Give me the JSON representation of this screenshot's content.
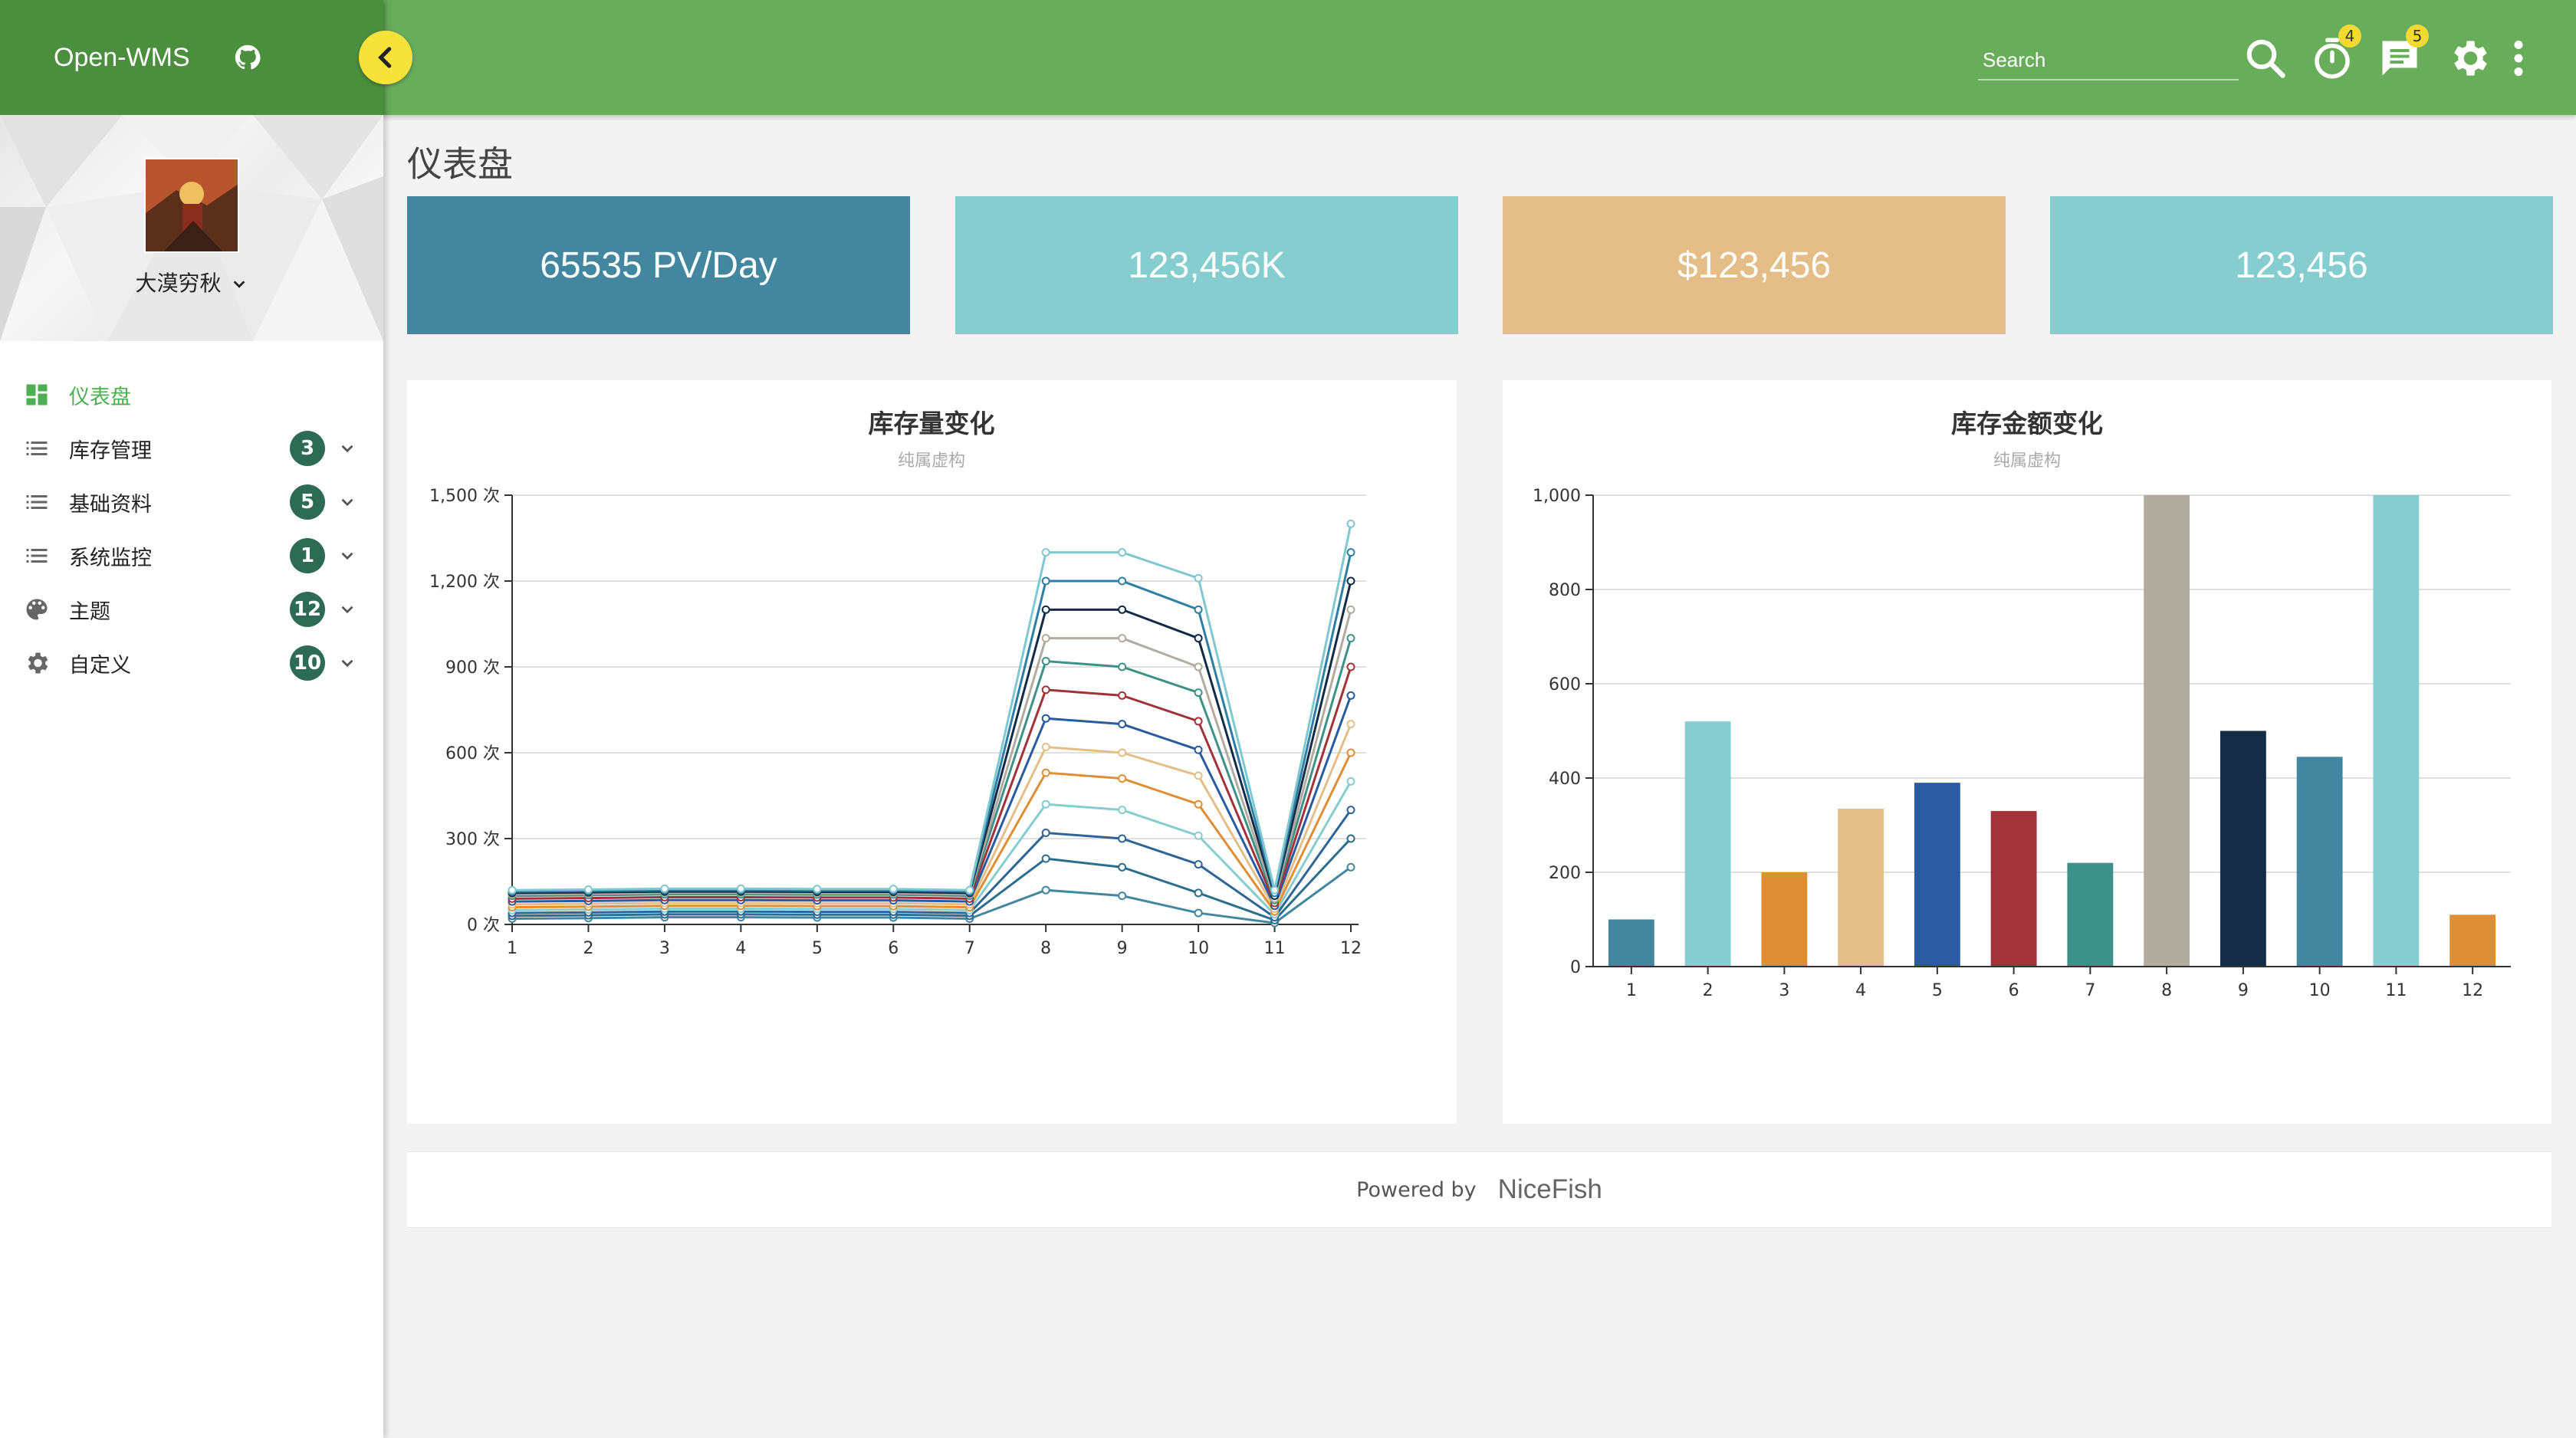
{
  "brand": {
    "name": "Open-WMS"
  },
  "user": {
    "name": "大漠穷秋"
  },
  "menu": [
    {
      "label": "仪表盘",
      "icon": "dashboard-icon",
      "badge": "",
      "active": true
    },
    {
      "label": "库存管理",
      "icon": "list-icon",
      "badge": "3"
    },
    {
      "label": "基础资料",
      "icon": "list-icon",
      "badge": "5"
    },
    {
      "label": "系统监控",
      "icon": "list-icon",
      "badge": "1"
    },
    {
      "label": "主题",
      "icon": "palette-icon",
      "badge": "12"
    },
    {
      "label": "自定义",
      "icon": "gear-icon",
      "badge": "10"
    }
  ],
  "topbar": {
    "search_placeholder": "Search",
    "timer_badge": "4",
    "message_badge": "5"
  },
  "page": {
    "title": "仪表盘"
  },
  "stats": [
    {
      "value": "65535 PV/Day",
      "color": "#42879f"
    },
    {
      "value": "123,456K",
      "color": "#85cdce"
    },
    {
      "value": "$123,456",
      "color": "#e4be86"
    },
    {
      "value": "123,456",
      "color": "#85cdce"
    }
  ],
  "chart_data": [
    {
      "type": "line",
      "title": "库存量变化",
      "subtitle": "纯属虚构",
      "x": [
        "1",
        "2",
        "3",
        "4",
        "5",
        "6",
        "7",
        "8",
        "9",
        "10",
        "11",
        "12"
      ],
      "y_unit": " 次",
      "ylim": [
        0,
        1500
      ],
      "yticks": [
        0,
        300,
        600,
        900,
        1200,
        1500
      ],
      "grid": true,
      "series": [
        {
          "color": "#42879f",
          "values": [
            20,
            22,
            25,
            25,
            24,
            24,
            20,
            120,
            100,
            40,
            5,
            200
          ]
        },
        {
          "color": "#2d6e8c",
          "values": [
            30,
            32,
            35,
            35,
            34,
            34,
            30,
            230,
            200,
            110,
            15,
            300
          ]
        },
        {
          "color": "#2e6496",
          "values": [
            40,
            42,
            45,
            45,
            44,
            44,
            40,
            320,
            300,
            210,
            25,
            400
          ]
        },
        {
          "color": "#85cdce",
          "values": [
            50,
            52,
            55,
            55,
            54,
            54,
            50,
            420,
            400,
            310,
            35,
            500
          ]
        },
        {
          "color": "#de8f36",
          "values": [
            60,
            62,
            65,
            65,
            64,
            64,
            60,
            530,
            510,
            420,
            45,
            600
          ]
        },
        {
          "color": "#e4be86",
          "values": [
            70,
            72,
            75,
            75,
            74,
            74,
            70,
            620,
            600,
            520,
            55,
            700
          ]
        },
        {
          "color": "#2a5aa0",
          "values": [
            80,
            82,
            85,
            85,
            84,
            84,
            80,
            720,
            700,
            610,
            65,
            800
          ]
        },
        {
          "color": "#a2323a",
          "values": [
            90,
            92,
            95,
            95,
            94,
            94,
            90,
            820,
            800,
            710,
            75,
            900
          ]
        },
        {
          "color": "#3d9186",
          "values": [
            100,
            102,
            105,
            105,
            104,
            104,
            100,
            920,
            900,
            810,
            85,
            1000
          ]
        },
        {
          "color": "#b1aba0",
          "values": [
            105,
            107,
            110,
            110,
            109,
            109,
            105,
            1000,
            1000,
            900,
            90,
            1100
          ]
        },
        {
          "color": "#142b47",
          "values": [
            110,
            112,
            115,
            115,
            114,
            114,
            110,
            1100,
            1100,
            1000,
            100,
            1200
          ]
        },
        {
          "color": "#2f7ea4",
          "values": [
            115,
            117,
            120,
            120,
            119,
            119,
            115,
            1200,
            1200,
            1100,
            110,
            1300
          ]
        },
        {
          "color": "#7fc8cf",
          "values": [
            120,
            122,
            125,
            125,
            124,
            124,
            120,
            1300,
            1300,
            1210,
            120,
            1400
          ]
        }
      ]
    },
    {
      "type": "bar",
      "title": "库存金额变化",
      "subtitle": "纯属虚构",
      "categories": [
        "1",
        "2",
        "3",
        "4",
        "5",
        "6",
        "7",
        "8",
        "9",
        "10",
        "11",
        "12"
      ],
      "values": [
        100,
        520,
        200,
        335,
        390,
        330,
        220,
        1000,
        500,
        445,
        1000,
        110
      ],
      "colors": [
        "#42879f",
        "#85cdce",
        "#de8f36",
        "#e4be86",
        "#2a5aa0",
        "#a2323a",
        "#3d9186",
        "#b1aba0",
        "#142b47",
        "#42879f",
        "#85cdce",
        "#de8f36"
      ],
      "ylim": [
        0,
        1000
      ],
      "yticks": [
        0,
        200,
        400,
        600,
        800,
        1000
      ],
      "grid": true
    }
  ],
  "footer": {
    "powered_by": "Powered by",
    "brand": "NiceFish"
  }
}
